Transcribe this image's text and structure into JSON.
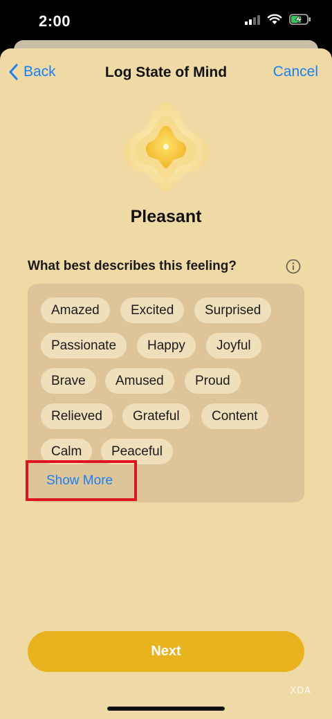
{
  "status_bar": {
    "time": "2:00"
  },
  "nav": {
    "back_label": "Back",
    "title": "Log State of Mind",
    "cancel_label": "Cancel"
  },
  "mood": {
    "label": "Pleasant"
  },
  "question": {
    "text": "What best describes this feeling?"
  },
  "feelings": [
    "Amazed",
    "Excited",
    "Surprised",
    "Passionate",
    "Happy",
    "Joyful",
    "Brave",
    "Amused",
    "Proud",
    "Relieved",
    "Grateful",
    "Content",
    "Calm",
    "Peaceful"
  ],
  "show_more_label": "Show More",
  "next_label": "Next",
  "watermark": "XDA",
  "colors": {
    "accent": "#1a7ef5",
    "sheet": "#efd9a4",
    "card": "#dec599",
    "chip": "#f0dfbb",
    "next": "#e9b31f",
    "highlight": "#e0141e"
  }
}
